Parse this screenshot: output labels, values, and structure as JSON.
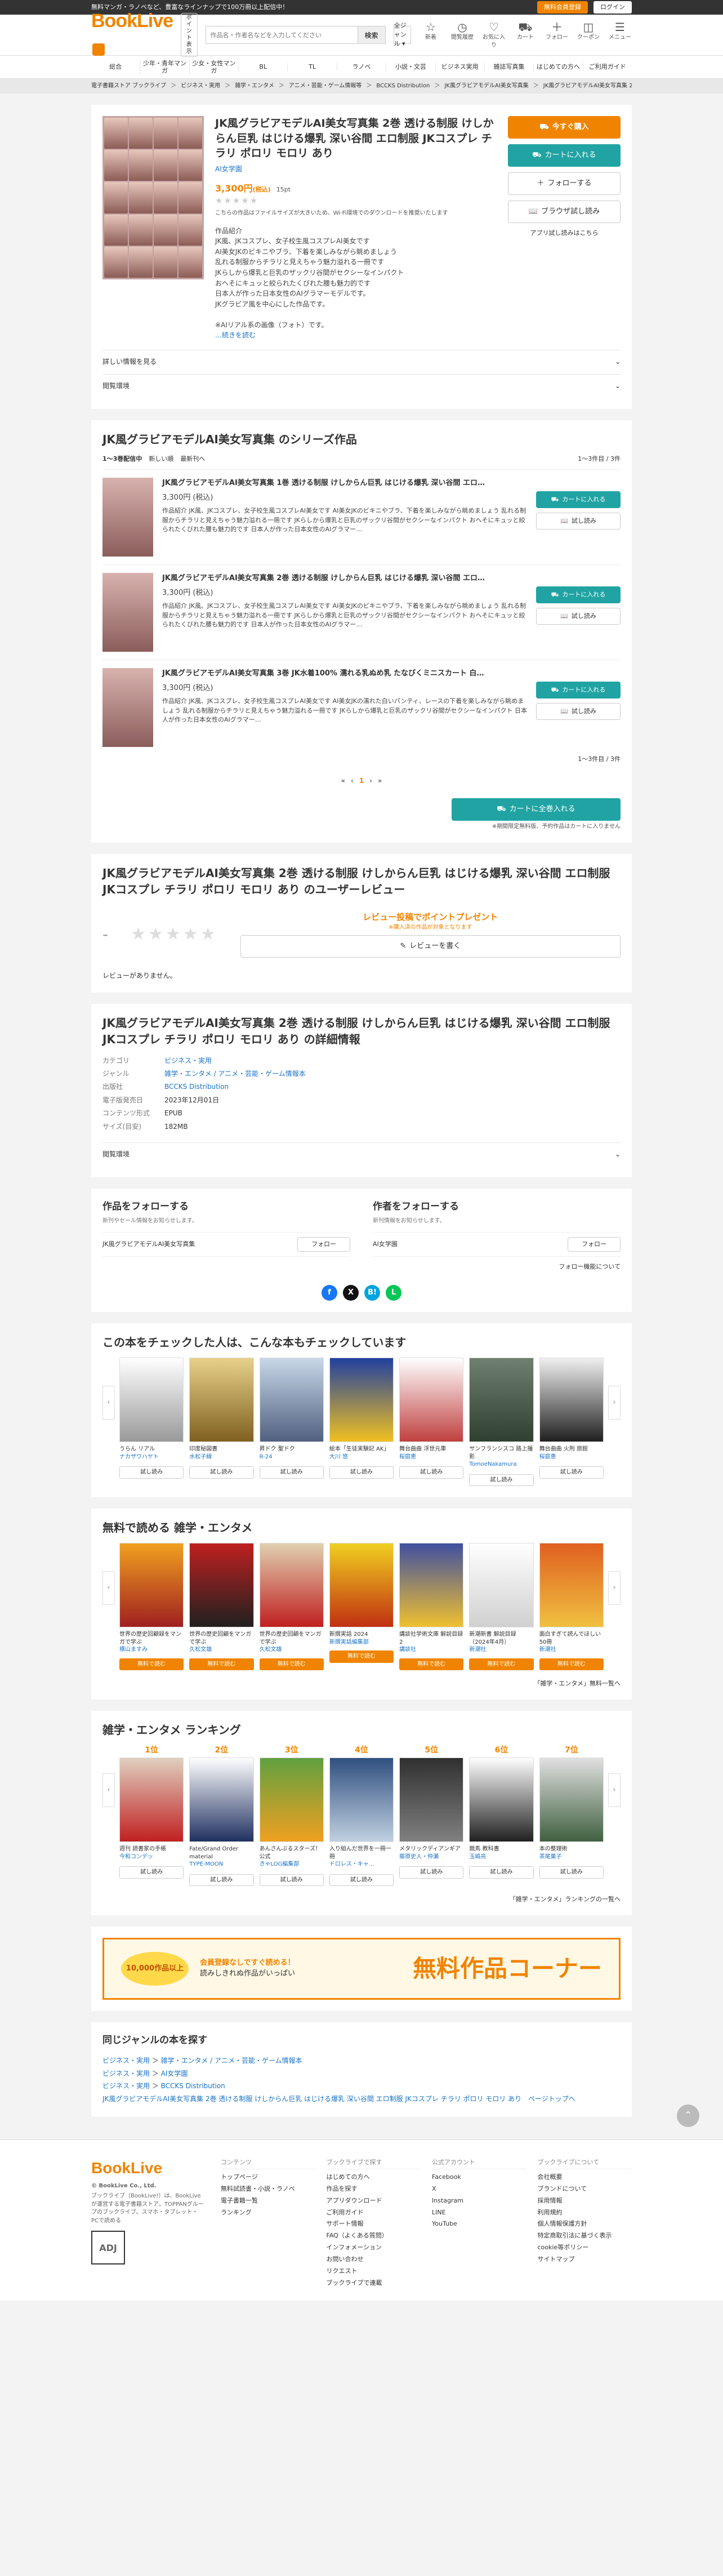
{
  "topbar": {
    "notice": "無料マンガ・ラノベなど、豊富なラインナップで100万冊以上配信中！",
    "register": "無料会員登録",
    "login": "ログイン"
  },
  "header": {
    "logo": "BookLive",
    "toggle": "ポイント表示",
    "search_placeholder": "作品名・作者名などを入力してください",
    "search_btn": "検索",
    "free_select": "全ジャンル ▾",
    "icons": [
      {
        "n": "new",
        "g": "☆",
        "l": "新着"
      },
      {
        "n": "history",
        "g": "◷",
        "l": "閲覧履歴"
      },
      {
        "n": "favorite",
        "g": "♡",
        "l": "お気に入り"
      },
      {
        "n": "cart",
        "g": "⛟",
        "l": "カート"
      },
      {
        "n": "follow",
        "g": "＋",
        "l": "フォロー"
      },
      {
        "n": "coupon",
        "g": "◫",
        "l": "クーポン"
      },
      {
        "n": "menu",
        "g": "☰",
        "l": "メニュー"
      }
    ]
  },
  "cats": [
    "総合",
    "少年・青年マンガ",
    "少女・女性マンガ",
    "BL",
    "TL",
    "ラノベ",
    "小説・文芸",
    "ビジネス実用",
    "雑誌写真集",
    "はじめての方へ",
    "ご利用ガイド"
  ],
  "crumbs": [
    "電子書籍ストア ブックライブ",
    "ビジネス・実用",
    "雑学・エンタメ",
    "アニメ・芸能・ゲーム情報等",
    "BCCKS Distribution",
    "JK風グラビアモデルAI美女写真集",
    "JK風グラビアモデルAI美女写真集 2巻 透ける制服"
  ],
  "product": {
    "title": "JK風グラビアモデルAI美女写真集 2巻 透ける制服 けしからん巨乳 はじける爆乳 深い谷間 エロ制服 JKコスプレ チラリ ポロリ モロリ あり",
    "author": "AI女学園",
    "price": "3,300円",
    "tax": "(税込)",
    "points": "15pt",
    "stars": "★★★★★",
    "note": "こちらの作品はファイルサイズが大きいため、Wi-Fi環境でのダウンロードを推奨いたします",
    "desc": [
      "作品紹介",
      "JK風、JKコスプレ、女子校生風コスプレAI美女です",
      "AI美女JKのビキニやブラ、下着を楽しみながら眺めましょう",
      "乱れる制服からチラリと見えちゃう魅力溢れる一冊です",
      "JKらしから爆乳と巨乳のザックリ谷間がセクシーなインパクト",
      "おへそにキュッと絞られたくびれた腰も魅力的です",
      "日本人が作った日本女性のAIグラマーモデルです。",
      "JKグラビア風を中心にした作品です。",
      "",
      "※AIリアル系の画像（フォト）です。"
    ],
    "more": "…続きを読む",
    "buy": "今すぐ購入",
    "cart": "カートに入れる",
    "follow": "フォローする",
    "browser": "ブラウザ試し読み",
    "app": "アプリ試し読みはこちら",
    "acc1": "詳しい情報を見る",
    "acc2": "閲覧環境"
  },
  "series": {
    "title": "JK風グラビアモデルAI美女写真集 のシリーズ作品",
    "range": "1〜3巻配信中",
    "sort1": "新しい順",
    "sort2": "最新刊へ",
    "count": "1〜3件目 / 3件",
    "items": [
      {
        "title": "JK風グラビアモデルAI美女写真集 1巻 透ける制服 けしからん巨乳 はじける爆乳 深い谷間 エロ…",
        "price": "3,300円 (税込)",
        "desc": "作品紹介 JK風、JKコスプレ、女子校生風コスプレAI美女です AI美女JKのビキニやブラ、下着を楽しみながら眺めましょう 乱れる制服からチラリと見えちゃう魅力溢れる一冊です JKらしから爆乳と巨乳のザックリ谷間がセクシーなインパクト おへそにキュッと絞られたくびれた腰も魅力的です 日本人が作った日本女性のAIグラマー…"
      },
      {
        "title": "JK風グラビアモデルAI美女写真集 2巻 透ける制服 けしからん巨乳 はじける爆乳 深い谷間 エロ…",
        "price": "3,300円 (税込)",
        "desc": "作品紹介 JK風、JKコスプレ、女子校生風コスプレAI美女です AI美女JKのビキニやブラ、下着を楽しみながら眺めましょう 乱れる制服からチラリと見えちゃう魅力溢れる一冊です JKらしから爆乳と巨乳のザックリ谷間がセクシーなインパクト おへそにキュッと絞られたくびれた腰も魅力的です 日本人が作った日本女性のAIグラマー…"
      },
      {
        "title": "JK風グラビアモデルAI美女写真集 3巻 JK水着100% 濡れる乳ぬめ乳 たなびくミニスカート 白…",
        "price": "3,300円 (税込)",
        "desc": "作品紹介 JK風、JKコスプレ、女子校生風コスプレAI美女です AI美女JKの濡れた白いパンティ、レースの下着を楽しみながら眺めましょう 乱れる制服からチラリと見えちゃう魅力溢れる一冊です JKらしから爆乳と巨乳のザックリ谷間がセクシーなインパクト 日本人が作った日本女性のAIグラマー…"
      }
    ],
    "cart": "カートに入れる",
    "trial": "試し読み",
    "count2": "1〜3件目 / 3件",
    "pages": [
      "«",
      "‹",
      "1",
      "›",
      "»"
    ],
    "bulk": "カートに全巻入れる",
    "bulk_note": "※期間限定無料版、予約作品はカートに入りません"
  },
  "review": {
    "title": "JK風グラビアモデルAI美女写真集 2巻 透ける制服 けしからん巨乳 はじける爆乳 深い谷間 エロ制服 JKコスプレ チラリ ポロリ モロリ あり のユーザーレビュー",
    "score": "-",
    "stars": "★★★★★",
    "promo": "レビュー投稿でポイントプレゼント",
    "sub": "※購入済の作品が対象となります",
    "write": "レビューを書く",
    "none": "レビューがありません。"
  },
  "info": {
    "title": "JK風グラビアモデルAI美女写真集 2巻 透ける制服 けしからん巨乳 はじける爆乳 深い谷間 エロ制服 JKコスプレ チラリ ポロリ モロリ あり の詳細情報",
    "rows": [
      {
        "k": "カテゴリ",
        "v": "ビジネス・実用"
      },
      {
        "k": "ジャンル",
        "v": "雑学・エンタメ / アニメ・芸能・ゲーム情報本"
      },
      {
        "k": "出版社",
        "v": "BCCKS Distribution"
      },
      {
        "k": "電子版発売日",
        "v": "2023年12月01日"
      },
      {
        "k": "コンテンツ形式",
        "v": "EPUB"
      },
      {
        "k": "サイズ(目安)",
        "v": "182MB"
      }
    ],
    "acc": "閲覧環境"
  },
  "follow": {
    "h1": "作品をフォローする",
    "s1": "新刊やセール情報をお知らせします。",
    "n1": "JK風グラビアモデルAI美女写真集",
    "h2": "作者をフォローする",
    "s2": "新刊情報をお知らせします。",
    "n2": "AI女学園",
    "btn": "フォロー",
    "about": "フォロー機能について"
  },
  "social": [
    {
      "n": "facebook",
      "t": "f",
      "c": "#1877f2"
    },
    {
      "n": "x",
      "t": "X",
      "c": "#111111"
    },
    {
      "n": "hatena",
      "t": "B!",
      "c": "#00a4de"
    },
    {
      "n": "line",
      "t": "L",
      "c": "#06c755"
    }
  ],
  "check": {
    "title": "この本をチェックした人は、こんな本もチェックしています",
    "btn": "試し読み",
    "books": [
      {
        "t": "うらん リアル",
        "a": "ナカザワハヤト",
        "c1": "#ffffff",
        "c2": "#999999"
      },
      {
        "t": "印度秘図書",
        "a": "水松子線",
        "c1": "#e8d08a",
        "c2": "#806020"
      },
      {
        "t": "昇ドク 聖ドク",
        "a": "R-24",
        "c1": "#c8d8e8",
        "c2": "#506080"
      },
      {
        "t": "絵本「生徒実験記 AK」",
        "a": "大川 悠",
        "c1": "#2040a0",
        "c2": "#f0c020"
      },
      {
        "t": "舞台曲曲 浮世元車",
        "a": "桜庭恵",
        "c1": "#ffffff",
        "c2": "#c04040"
      },
      {
        "t": "サンフランシスコ 路上撮影",
        "a": "TomoeNakamura",
        "c1": "#708070",
        "c2": "#304030"
      },
      {
        "t": "舞台曲曲 火刑 旅館",
        "a": "桜庭恵",
        "c1": "#f0f0f0",
        "c2": "#202020"
      }
    ]
  },
  "free": {
    "title": "無料で読める 雑学・エンタメ",
    "btn": "無料で読む",
    "more": "「雑学・エンタメ」無料一覧へ",
    "books": [
      {
        "t": "世界の歴史回顧録をマンガで学ぶ",
        "a": "横山ますみ",
        "c1": "#f0a020",
        "c2": "#a02020"
      },
      {
        "t": "世界の歴史回顧をマンガで学ぶ",
        "a": "久松文雄",
        "c1": "#c02020",
        "c2": "#202020"
      },
      {
        "t": "世界の歴史回顧をマンガで学ぶ",
        "a": "久松文雄",
        "c1": "#e0d0b0",
        "c2": "#c02020"
      },
      {
        "t": "新撰実話 2024",
        "a": "新撰実話編集部",
        "c1": "#f0d020",
        "c2": "#c03010"
      },
      {
        "t": "講談社学術文庫 解説目録 2",
        "a": "講談社",
        "c1": "#4050a0",
        "c2": "#f0c030"
      },
      {
        "t": "新潮新書 解説目録（2024年4月）",
        "a": "新潮社",
        "c1": "#ffffff",
        "c2": "#d0d0d0"
      },
      {
        "t": "面白すぎて読んでほしい50冊",
        "a": "新潮社",
        "c1": "#e06020",
        "c2": "#f0c040"
      }
    ]
  },
  "ranking": {
    "title": "雑学・エンタメ ランキング",
    "btn": "試し読み",
    "more": "「雑学・エンタメ」ランキングの一覧へ",
    "books": [
      {
        "r": "1位",
        "t": "週刊 読書家の手帳",
        "a": "今和コンデッ",
        "c1": "#e0d0c0",
        "c2": "#c02020"
      },
      {
        "r": "2位",
        "t": "Fate/Grand Order material",
        "a": "TYPE-MOON",
        "c1": "#ffffff",
        "c2": "#203060"
      },
      {
        "r": "3位",
        "t": "あんさんぶるスターズ！公式",
        "a": "きゃLOG編集部",
        "c1": "#60a040",
        "c2": "#f0a020"
      },
      {
        "r": "4位",
        "t": "入り組んだ世界を一冊一冊",
        "a": "ドロレス・キャ…",
        "c1": "#305080",
        "c2": "#c0d0e0"
      },
      {
        "r": "5位",
        "t": "メタリックディアンギア",
        "a": "藤原史人・仲瀬",
        "c1": "#303030",
        "c2": "#808080"
      },
      {
        "r": "6位",
        "t": "競馬 教科書",
        "a": "玉嶋亮",
        "c1": "#ffffff",
        "c2": "#202020"
      },
      {
        "r": "7位",
        "t": "本の整理術",
        "a": "茶尾菓子",
        "c1": "#e0e0e0",
        "c2": "#406040"
      }
    ]
  },
  "banner": {
    "badge": "10,000作品以上",
    "mid1": "会員登録なしですぐ読める！",
    "mid2": "読みしきれぬ作品がいっぱい",
    "big": "無料作品コーナー"
  },
  "genre": {
    "title": "同じジャンルの本を探す",
    "l1": [
      "ビジネス・実用",
      "雑学・エンタメ / アニメ・芸能・ゲーム情報本"
    ],
    "l2": [
      "ビジネス・実用",
      "AI女学園"
    ],
    "l3": [
      "ビジネス・実用",
      "BCCKS Distribution"
    ],
    "l4": "JK風グラビアモデルAI美女写真集 2巻 透ける制服 けしからん巨乳 はじける爆乳 深い谷間 エロ制服 JKコスプレ チラリ ポロリ モロリ あり　ページトップへ"
  },
  "footer": {
    "logo": "BookLive",
    "copy": "© BookLive Co., Ltd.",
    "desc": "ブックライブ（BookLive!）は、BookLiveが運営する電子書籍ストア。TOPPANグループのブックライブ。スマホ・タブレット・PCで読める",
    "cols": [
      {
        "h": "コンテンツ",
        "i": [
          "トップページ",
          "無料試読書・小説・ラノベ",
          "電子書籍一覧",
          "ランキング"
        ]
      },
      {
        "h": "ブックライブで探す",
        "i": [
          "はじめての方へ",
          "作品を探す",
          "アプリダウンロード",
          "ご利用ガイド",
          "サポート情報",
          "FAQ（よくある質問）",
          "インフォメーション",
          "お問い合わせ",
          "リクエスト",
          "ブックライブで連載"
        ]
      },
      {
        "h": "公式アカウント",
        "i": [
          "Facebook",
          "X",
          "Instagram",
          "LINE",
          "YouTube"
        ]
      },
      {
        "h": "ブックライブについて",
        "i": [
          "会社概要",
          "ブランドについて",
          "採用情報",
          "利用規約",
          "個人情報保護方針",
          "特定商取引法に基づく表示",
          "cookie等ポリシー",
          "サイトマップ"
        ]
      }
    ]
  }
}
